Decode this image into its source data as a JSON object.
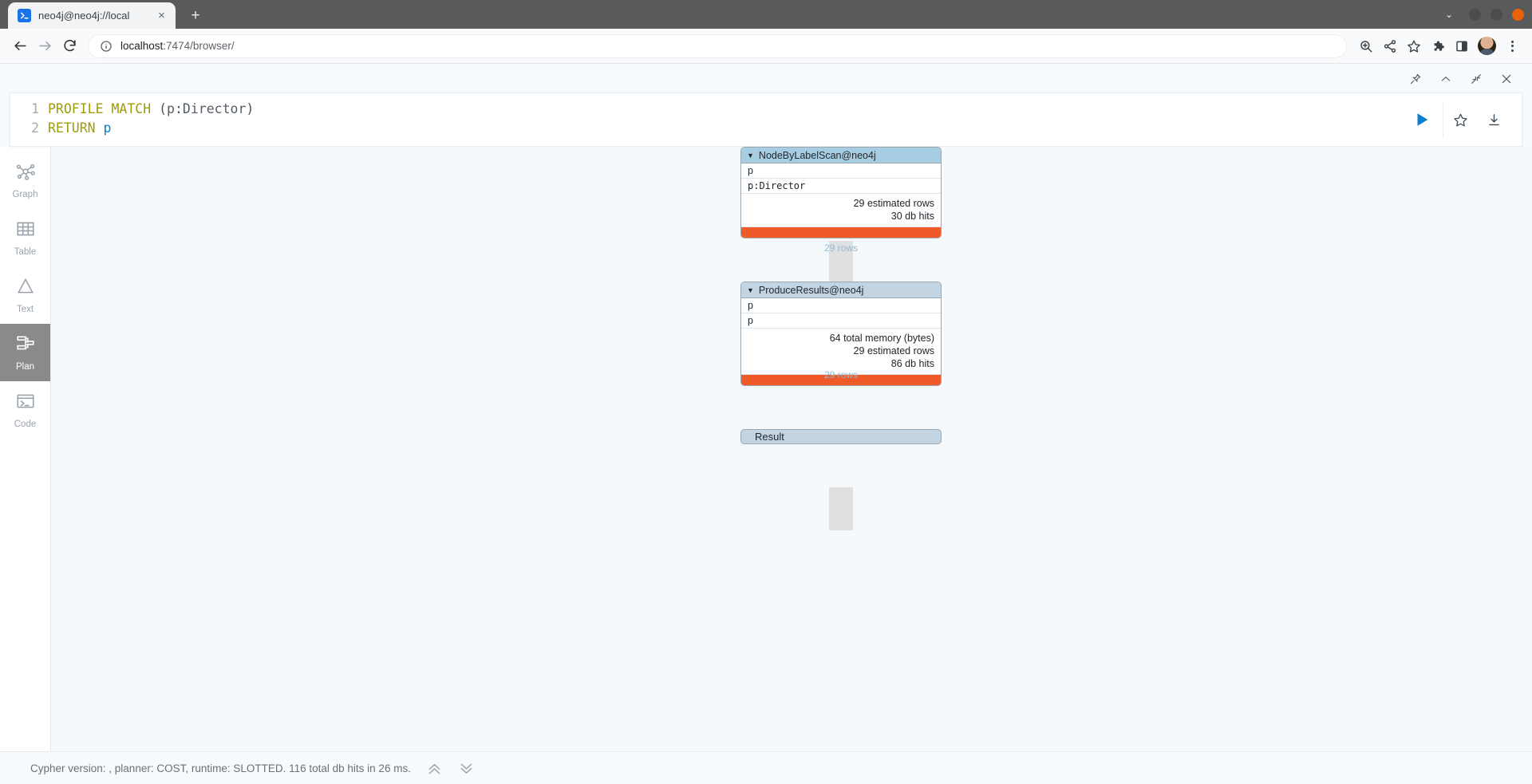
{
  "browser": {
    "tab": {
      "title": "neo4j@neo4j://local",
      "favicon": "terminal-icon",
      "close_label": "×"
    },
    "new_tab_label": "+",
    "window_controls": {
      "chevron": "⌄",
      "minimize": "minimize-button",
      "maximize": "maximize-button",
      "close": "close-button"
    },
    "nav": {
      "back": "back-icon",
      "forward": "forward-icon",
      "reload": "reload-icon"
    },
    "omnibox": {
      "info_icon": "site-info-icon",
      "url_host": "localhost",
      "url_path": ":7474/browser/"
    },
    "toolbar_icons": [
      "zoom-icon",
      "share-icon",
      "bookmark-star-icon",
      "extensions-puzzle-icon",
      "sidebar-panel-icon",
      "profile-avatar",
      "chrome-menu-icon"
    ]
  },
  "editor": {
    "topbar_icons": [
      "pin-icon",
      "chevron-up-icon",
      "collapse-icon",
      "close-icon"
    ],
    "lines": [
      {
        "number": "1",
        "tokens": [
          {
            "text": "PROFILE",
            "cls": "kw"
          },
          {
            "text": " ",
            "cls": "pn"
          },
          {
            "text": "MATCH",
            "cls": "kw"
          },
          {
            "text": " ",
            "cls": "pn"
          },
          {
            "text": "(",
            "cls": "punct"
          },
          {
            "text": "p",
            "cls": "pn"
          },
          {
            "text": ":",
            "cls": "punct"
          },
          {
            "text": "Director",
            "cls": "pn"
          },
          {
            "text": ")",
            "cls": "punct"
          }
        ]
      },
      {
        "number": "2",
        "tokens": [
          {
            "text": "RETURN",
            "cls": "kw"
          },
          {
            "text": " ",
            "cls": "pn"
          },
          {
            "text": "p",
            "cls": "var"
          }
        ]
      }
    ],
    "run_label": "run-query-button",
    "favorite_label": "save-as-favorite-button",
    "download_label": "download-button"
  },
  "views": [
    {
      "id": "graph",
      "label": "Graph",
      "icon": "graph-icon",
      "active": false
    },
    {
      "id": "table",
      "label": "Table",
      "icon": "table-icon",
      "active": false
    },
    {
      "id": "text",
      "label": "Text",
      "icon": "text-icon",
      "active": false
    },
    {
      "id": "plan",
      "label": "Plan",
      "icon": "plan-icon",
      "active": true
    },
    {
      "id": "code",
      "label": "Code",
      "icon": "code-icon",
      "active": false
    }
  ],
  "plan": {
    "nodes": [
      {
        "title": "NodeByLabelScan@neo4j",
        "caret": "▼",
        "header_style": "hdr-a",
        "rows": [
          {
            "text": "p",
            "mono": false
          },
          {
            "text": "p:Director",
            "mono": true
          }
        ],
        "stats": [
          "29 estimated rows",
          "30 db hits"
        ],
        "bar_color": "#f05a28",
        "edge_label": "29 rows"
      },
      {
        "title": "ProduceResults@neo4j",
        "caret": "▼",
        "header_style": "hdr-b",
        "rows": [
          {
            "text": "p",
            "mono": false
          },
          {
            "text": "p",
            "mono": false
          }
        ],
        "stats": [
          "64 total memory (bytes)",
          "29 estimated rows",
          "86 db hits"
        ],
        "bar_color": "#f05a28",
        "edge_label": "29 rows"
      }
    ],
    "result_label": "Result"
  },
  "status": {
    "text": "Cypher version: , planner: COST, runtime: SLOTTED. 116 total db hits in 26 ms.",
    "collapse_icon": "chevrons-up-icon",
    "expand_icon": "chevrons-down-icon"
  },
  "colors": {
    "accent_orange": "#f05a28",
    "node_header_primary": "#a7cde2",
    "node_header_secondary": "#c3d4e3",
    "rows_label": "#8fb9d6",
    "run_blue": "#0b7ecb",
    "active_view": "#8a8a8a"
  }
}
